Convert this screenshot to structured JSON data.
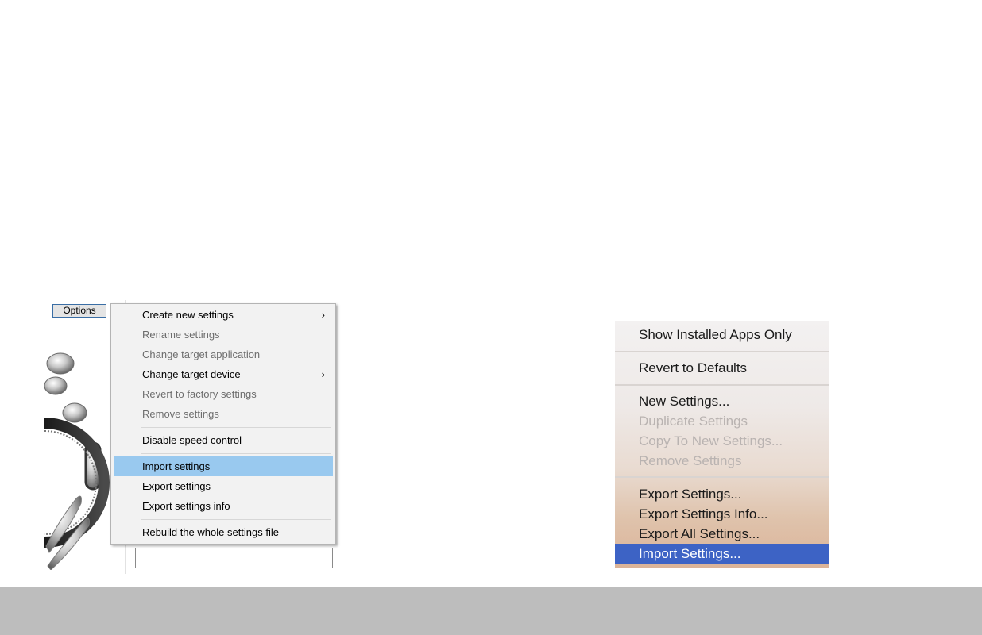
{
  "win": {
    "options_label": "Options",
    "menu_items": [
      {
        "label": "Create new settings",
        "submenu": true
      },
      {
        "label": "Rename settings",
        "disabled": true
      },
      {
        "label": "Change target application",
        "disabled": true
      },
      {
        "label": "Change target device",
        "submenu": true
      },
      {
        "label": "Revert to factory settings",
        "disabled": true
      },
      {
        "label": "Remove settings",
        "disabled": true
      },
      {
        "label": "Disable speed control"
      },
      {
        "label": "Import settings",
        "highlighted": true
      },
      {
        "label": "Export settings"
      },
      {
        "label": "Export settings info"
      },
      {
        "label": "Rebuild the whole settings file"
      }
    ],
    "submenu_arrow": "›",
    "highlight_color": "#99c9ef"
  },
  "mac": {
    "menu_items": [
      {
        "label": "Show Installed Apps Only"
      },
      {
        "label": "Revert to Defaults"
      },
      {
        "label": "New Settings..."
      },
      {
        "label": "Duplicate Settings",
        "disabled": true
      },
      {
        "label": "Copy To New Settings...",
        "disabled": true
      },
      {
        "label": "Remove Settings",
        "disabled": true
      },
      {
        "label": "Export Settings..."
      },
      {
        "label": "Export Settings Info..."
      },
      {
        "label": "Export All Settings..."
      },
      {
        "label": "Import Settings...",
        "highlighted": true
      }
    ],
    "highlight_color": "#3d63c5"
  }
}
